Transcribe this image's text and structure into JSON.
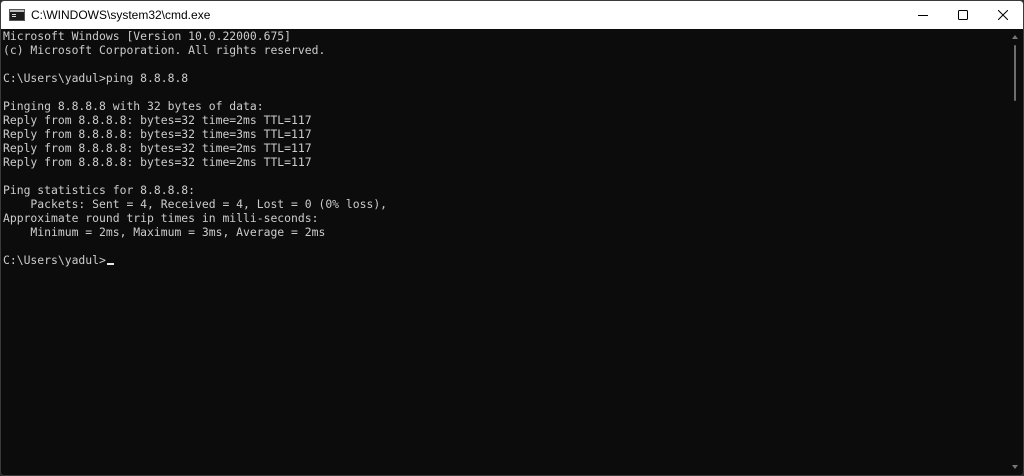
{
  "window": {
    "title": "C:\\WINDOWS\\system32\\cmd.exe",
    "icon": "console-icon",
    "controls": {
      "minimize_icon": "minimize-icon",
      "maximize_icon": "maximize-icon",
      "close_icon": "close-icon"
    }
  },
  "console": {
    "lines": [
      "Microsoft Windows [Version 10.0.22000.675]",
      "(c) Microsoft Corporation. All rights reserved.",
      "",
      "C:\\Users\\yadul>ping 8.8.8.8",
      "",
      "Pinging 8.8.8.8 with 32 bytes of data:",
      "Reply from 8.8.8.8: bytes=32 time=2ms TTL=117",
      "Reply from 8.8.8.8: bytes=32 time=3ms TTL=117",
      "Reply from 8.8.8.8: bytes=32 time=2ms TTL=117",
      "Reply from 8.8.8.8: bytes=32 time=2ms TTL=117",
      "",
      "Ping statistics for 8.8.8.8:",
      "    Packets: Sent = 4, Received = 4, Lost = 0 (0% loss),",
      "Approximate round trip times in milli-seconds:",
      "    Minimum = 2ms, Maximum = 3ms, Average = 2ms",
      ""
    ],
    "prompt": "C:\\Users\\yadul>",
    "text_color": "#cccccc",
    "background_color": "#0c0c0c"
  }
}
